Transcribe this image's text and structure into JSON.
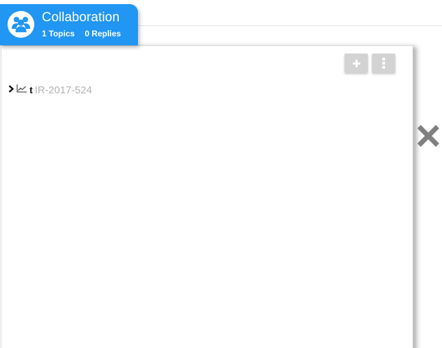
{
  "header": {
    "title": "Collaboration",
    "topics_count": "1",
    "topics_label": "Topics",
    "replies_count": "0",
    "replies_label": "Replies",
    "avatar_icon": "users-group-icon",
    "accent_color": "#2196f3"
  },
  "toolbar": {
    "add_icon": "plus-icon",
    "more_icon": "vertical-ellipsis-icon"
  },
  "tree": {
    "items": [
      {
        "expand_icon": "chevron-right-icon",
        "type_icon": "line-chart-icon",
        "prefix": "t",
        "label": "IR-2017-524"
      }
    ]
  },
  "close_icon": "close-x-icon"
}
